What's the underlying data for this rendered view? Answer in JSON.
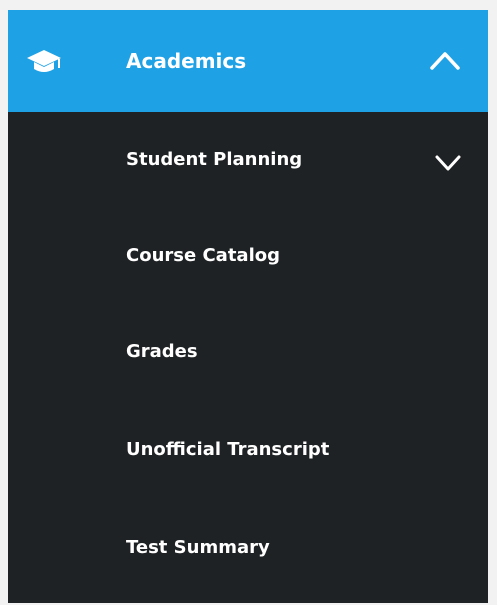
{
  "menu": {
    "section_title": "Academics",
    "section_icon": "graduation-cap-icon",
    "toggle_icon": "chevron-up-icon",
    "accent_color": "#1fa1e6",
    "background_color": "#1f2224",
    "items": [
      {
        "label": "Student Planning",
        "icon": "chevron-down-icon",
        "expandable": true
      },
      {
        "label": "Course Catalog"
      },
      {
        "label": "Grades"
      },
      {
        "label": "Unofficial Transcript"
      },
      {
        "label": "Test Summary"
      }
    ]
  }
}
